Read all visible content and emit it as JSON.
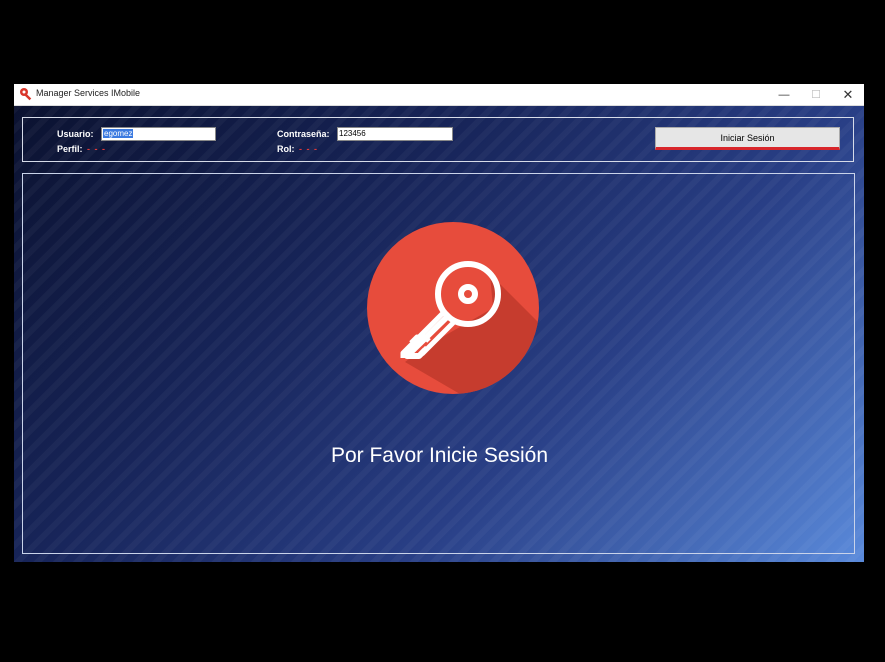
{
  "window": {
    "title": "Manager Services IMobile",
    "controls": {
      "minimize": "—",
      "maximize": "☐",
      "close": "✕"
    }
  },
  "login": {
    "usuario_label": "Usuario:",
    "usuario_value": "egomez",
    "contrasena_label": "Contraseña:",
    "contrasena_value": "123456",
    "perfil_label": "Perfil:",
    "perfil_value": "- - -",
    "rol_label": "Rol:",
    "rol_value": "- - -",
    "button_label": "Iniciar Sesión"
  },
  "main": {
    "icon": "key-icon",
    "message": "Por Favor Inicie Sesión"
  },
  "colors": {
    "accent_red": "#e74c3c",
    "button_underline": "#d8262b",
    "dash_red": "#e03a3a"
  }
}
